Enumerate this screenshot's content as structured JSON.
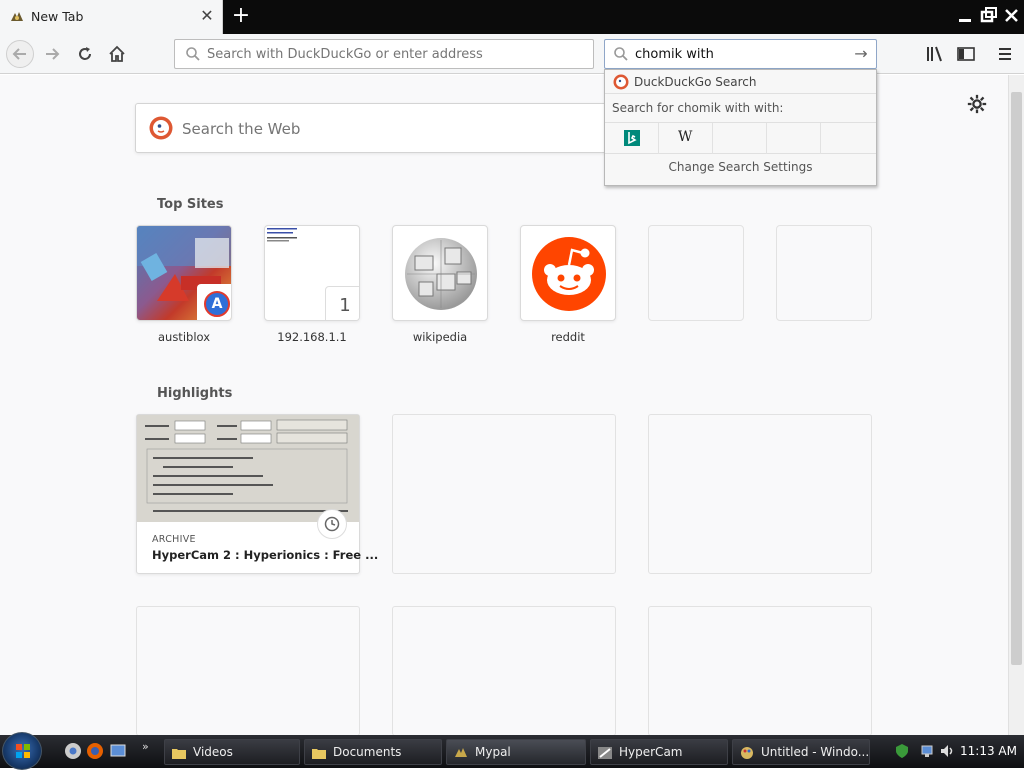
{
  "tab": {
    "title": "New Tab"
  },
  "urlbar": {
    "placeholder": "Search with DuckDuckGo or enter address"
  },
  "searchbar": {
    "value": "chomik with"
  },
  "search_popup": {
    "engine_label": "DuckDuckGo Search",
    "search_for": "Search for chomik with with:",
    "engine_icons": [
      "bing-icon",
      "wikipedia-icon"
    ],
    "wiki_glyph": "W",
    "change_settings": "Change Search Settings"
  },
  "page": {
    "search_placeholder": "Search the Web",
    "top_sites_title": "Top Sites",
    "highlights_title": "Highlights",
    "top_sites": [
      {
        "label": "austiblox",
        "badge": "A"
      },
      {
        "label": "192.168.1.1",
        "badge": "1"
      },
      {
        "label": "wikipedia"
      },
      {
        "label": "reddit"
      }
    ],
    "highlight": {
      "context": "ARCHIVE",
      "title": "HyperCam 2 : Hyperionics : Free ..."
    }
  },
  "taskbar": {
    "tasks": [
      "Videos",
      "Documents",
      "Mypal",
      "HyperCam",
      "Untitled - Windo..."
    ],
    "clock": "11:13 AM"
  },
  "colors": {
    "reddit": "#ff4500",
    "bing": "#00897b",
    "ddg": "#de5833",
    "accent": "#8fa6c8"
  }
}
